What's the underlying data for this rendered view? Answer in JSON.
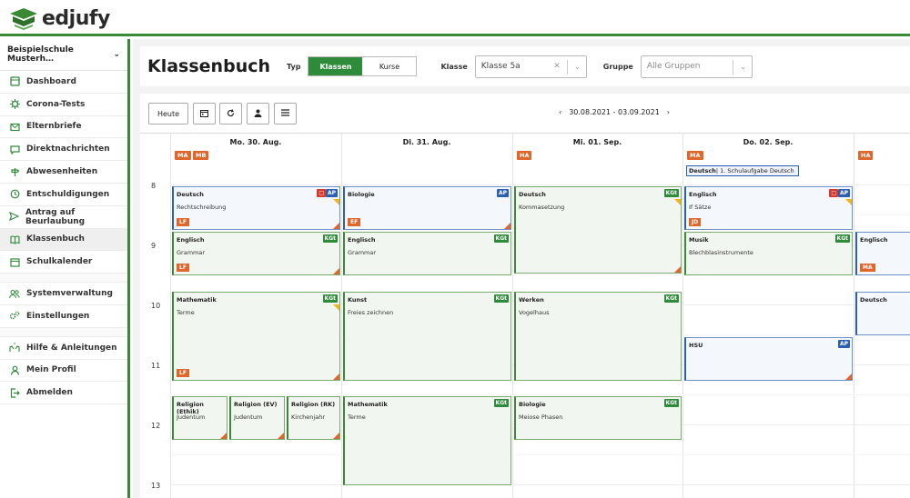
{
  "brand": {
    "name": "edjufy",
    "color": "#3a8a35"
  },
  "sidebar": {
    "school": "Beispielschule Musterh…",
    "group1": [
      {
        "label": "Dashboard",
        "icon": "dashboard-icon"
      },
      {
        "label": "Corona-Tests",
        "icon": "virus-icon"
      },
      {
        "label": "Elternbriefe",
        "icon": "envelope-icon"
      },
      {
        "label": "Direktnachrichten",
        "icon": "chat-icon"
      },
      {
        "label": "Abwesenheiten",
        "icon": "signpost-icon"
      },
      {
        "label": "Entschuldigungen",
        "icon": "clock-icon"
      },
      {
        "label": "Antrag auf Beurlaubung",
        "icon": "plane-icon"
      },
      {
        "label": "Klassenbuch",
        "icon": "book-icon"
      },
      {
        "label": "Schulkalender",
        "icon": "calendar-icon"
      }
    ],
    "group2": [
      {
        "label": "Systemverwaltung",
        "icon": "users-icon"
      },
      {
        "label": "Einstellungen",
        "icon": "gears-icon"
      }
    ],
    "group3": [
      {
        "label": "Hilfe & Anleitungen",
        "icon": "hands-icon"
      },
      {
        "label": "Mein Profil",
        "icon": "user-icon"
      },
      {
        "label": "Abmelden",
        "icon": "logout-icon"
      }
    ]
  },
  "header": {
    "title": "Klassenbuch",
    "typ_label": "Typ",
    "typ_options": [
      "Klassen",
      "Kurse"
    ],
    "klasse_label": "Klasse",
    "klasse_value": "Klasse 5a",
    "gruppe_label": "Gruppe",
    "gruppe_placeholder": "Alle Gruppen"
  },
  "toolbar": {
    "today": "Heute",
    "date_range": "30.08.2021 - 03.09.2021"
  },
  "calendar": {
    "days": [
      "Mo. 30. Aug.",
      "Di. 31. Aug.",
      "Mi. 01. Sep.",
      "Do. 02. Sep."
    ],
    "hours": [
      "8",
      "9",
      "10",
      "11",
      "12",
      "13"
    ],
    "day_badges": [
      [
        "MA",
        "MB"
      ],
      [],
      [
        "HA"
      ],
      [
        "MA"
      ],
      [
        "HA"
      ]
    ],
    "event": {
      "subject": "Deutsch",
      "text": "| 1. Schulaufgabe Deutsch"
    },
    "lessons": [
      {
        "title": "Deutsch",
        "sub": "Rechtschreibung",
        "tag": "AP",
        "red": true,
        "badge": "LF"
      },
      {
        "title": "Biologie",
        "sub": "",
        "tag": "AP",
        "badge": "EF"
      },
      {
        "title": "Deutsch",
        "sub": "Kommasetzung",
        "tag": "KGt",
        "badge": ""
      },
      {
        "title": "Englisch",
        "sub": "If Sätze",
        "tag": "AP",
        "red": true,
        "badge": "JD"
      },
      {
        "title": "Englisch",
        "sub": "Grammar",
        "tag": "KGt",
        "badge": "LF"
      },
      {
        "title": "Englisch",
        "sub": "Grammar",
        "tag": "KGt",
        "badge": ""
      },
      {
        "title": "Musik",
        "sub": "Blechblasinstrumente",
        "tag": "KGt",
        "badge": ""
      },
      {
        "title": "Englisch",
        "sub": "",
        "tag": "",
        "badge": "MA"
      },
      {
        "title": "Mathematik",
        "sub": "Terme",
        "tag": "KGt",
        "badge": "LF"
      },
      {
        "title": "Kunst",
        "sub": "Freies zeichnen",
        "tag": "KGt",
        "badge": ""
      },
      {
        "title": "Werken",
        "sub": "Vogelhaus",
        "tag": "KGt",
        "badge": ""
      },
      {
        "title": "Deutsch",
        "sub": "",
        "tag": "",
        "badge": ""
      },
      {
        "title": "HSU",
        "sub": "",
        "tag": "AP",
        "badge": ""
      },
      {
        "title": "Religion (Ethik)",
        "sub": "Judentum",
        "tag": "",
        "badge": ""
      },
      {
        "title": "Religion (EV)",
        "sub": "Judentum",
        "tag": "",
        "badge": ""
      },
      {
        "title": "Religion (RK)",
        "sub": "Kirchenjahr",
        "tag": "",
        "badge": ""
      },
      {
        "title": "Mathematik",
        "sub": "Terme",
        "tag": "KGt",
        "badge": ""
      },
      {
        "title": "Biologie",
        "sub": "Meiose Phasen",
        "tag": "KGt",
        "badge": ""
      }
    ]
  }
}
